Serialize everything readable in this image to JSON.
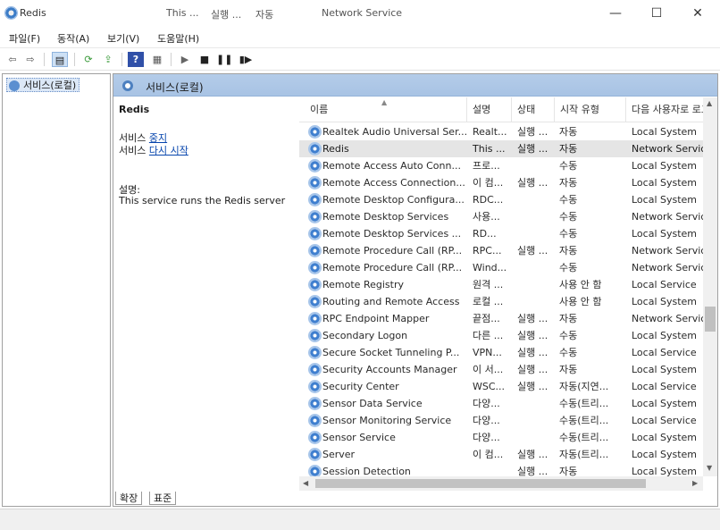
{
  "window": {
    "title": "Redis",
    "ghost_header": [
      "This ...",
      "실행 ...",
      "자동",
      "Network Service"
    ],
    "controls": {
      "minimize": "—",
      "maximize": "☐",
      "close": "✕"
    }
  },
  "menu": [
    "파일(F)",
    "동작(A)",
    "보기(V)",
    "도움말(H)"
  ],
  "toolbar": {
    "icons": [
      "back-icon",
      "forward-icon",
      "console-tree-icon",
      "refresh-icon",
      "export-icon",
      "help-icon",
      "properties-icon",
      "start-icon",
      "stop-icon",
      "pause-icon",
      "restart-icon"
    ]
  },
  "tree": {
    "root": "서비스(로컬)"
  },
  "pane_header": "서비스(로컬)",
  "description": {
    "name": "Redis",
    "start_prefix": "서비스",
    "start_link": "중지",
    "restart_prefix": "서비스",
    "restart_link": "다시 시작",
    "desc_label": "설명:",
    "desc_text": "This service runs the Redis server"
  },
  "columns": [
    "이름",
    "설명",
    "상태",
    "시작 유형",
    "다음 사용자로 로그온"
  ],
  "rows": [
    {
      "name": "Realtek Audio Universal Ser...",
      "desc": "Realt...",
      "status": "실행 ...",
      "startup": "자동",
      "logon": "Local System"
    },
    {
      "name": "Redis",
      "desc": "This ...",
      "status": "실행 ...",
      "startup": "자동",
      "logon": "Network Service",
      "selected": true
    },
    {
      "name": "Remote Access Auto Conn...",
      "desc": "프로...",
      "status": "",
      "startup": "수동",
      "logon": "Local System"
    },
    {
      "name": "Remote Access Connection...",
      "desc": "이 컴...",
      "status": "실행 ...",
      "startup": "자동",
      "logon": "Local System"
    },
    {
      "name": "Remote Desktop Configura...",
      "desc": "RDC...",
      "status": "",
      "startup": "수동",
      "logon": "Local System"
    },
    {
      "name": "Remote Desktop Services",
      "desc": "사용...",
      "status": "",
      "startup": "수동",
      "logon": "Network Service"
    },
    {
      "name": "Remote Desktop Services ...",
      "desc": "RD...",
      "status": "",
      "startup": "수동",
      "logon": "Local System"
    },
    {
      "name": "Remote Procedure Call (RP...",
      "desc": "RPC...",
      "status": "실행 ...",
      "startup": "자동",
      "logon": "Network Service"
    },
    {
      "name": "Remote Procedure Call (RP...",
      "desc": "Wind...",
      "status": "",
      "startup": "수동",
      "logon": "Network Service"
    },
    {
      "name": "Remote Registry",
      "desc": "원격 ...",
      "status": "",
      "startup": "사용 안 함",
      "logon": "Local Service"
    },
    {
      "name": "Routing and Remote Access",
      "desc": "로컬 ...",
      "status": "",
      "startup": "사용 안 함",
      "logon": "Local System"
    },
    {
      "name": "RPC Endpoint Mapper",
      "desc": "끝점...",
      "status": "실행 ...",
      "startup": "자동",
      "logon": "Network Service"
    },
    {
      "name": "Secondary Logon",
      "desc": "다른 ...",
      "status": "실행 ...",
      "startup": "수동",
      "logon": "Local System"
    },
    {
      "name": "Secure Socket Tunneling P...",
      "desc": "VPN...",
      "status": "실행 ...",
      "startup": "수동",
      "logon": "Local Service"
    },
    {
      "name": "Security Accounts Manager",
      "desc": "이 서...",
      "status": "실행 ...",
      "startup": "자동",
      "logon": "Local System"
    },
    {
      "name": "Security Center",
      "desc": "WSC...",
      "status": "실행 ...",
      "startup": "자동(지연...",
      "logon": "Local Service"
    },
    {
      "name": "Sensor Data Service",
      "desc": "다양...",
      "status": "",
      "startup": "수동(트리...",
      "logon": "Local System"
    },
    {
      "name": "Sensor Monitoring Service",
      "desc": "다양...",
      "status": "",
      "startup": "수동(트리...",
      "logon": "Local Service"
    },
    {
      "name": "Sensor Service",
      "desc": "다양...",
      "status": "",
      "startup": "수동(트리...",
      "logon": "Local System"
    },
    {
      "name": "Server",
      "desc": "이 컴...",
      "status": "실행 ...",
      "startup": "자동(트리...",
      "logon": "Local System"
    },
    {
      "name": "Session Detection",
      "desc": "",
      "status": "실행 ...",
      "startup": "자동",
      "logon": "Local System"
    }
  ],
  "tabs": [
    "확장",
    "표준"
  ],
  "colors": {
    "header_blue": "#a8c3e4",
    "link": "#0645ad",
    "selected_row": "#e5e5e5"
  }
}
